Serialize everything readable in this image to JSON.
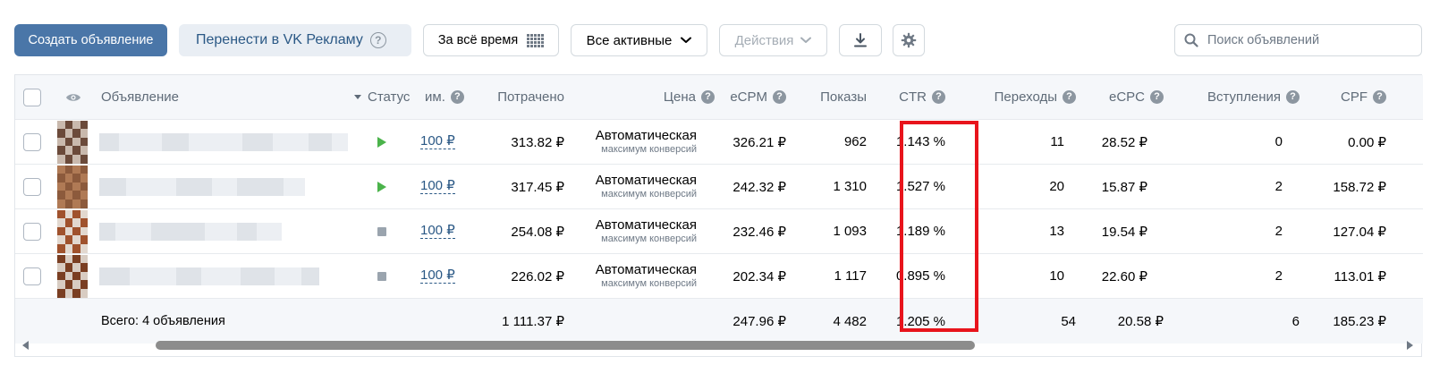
{
  "toolbar": {
    "create_label": "Создать объявление",
    "transfer_label": "Перенести в VK Рекламу",
    "period_label": "За всё время",
    "filter_label": "Все активные",
    "actions_label": "Действия",
    "search_placeholder": "Поиск объявлений"
  },
  "table": {
    "headers": {
      "ad": "Объявление",
      "status": "Статус",
      "budget": "им.",
      "spent": "Потрачено",
      "price": "Цена",
      "ecpm": "eCPM",
      "impressions": "Показы",
      "ctr": "CTR",
      "clicks": "Переходы",
      "ecpc": "eCPC",
      "joins": "Вступления",
      "cpf": "CPF"
    },
    "rows": [
      {
        "status": "active",
        "budget": "100 ₽",
        "spent": "313.82 ₽",
        "price_mode": "Автоматическая",
        "price_sub": "максимум конверсий",
        "ecpm": "326.21 ₽",
        "impressions": "962",
        "ctr": "1.143 %",
        "clicks": "11",
        "ecpc": "28.52 ₽",
        "joins": "0",
        "cpf": "0.00 ₽"
      },
      {
        "status": "active",
        "budget": "100 ₽",
        "spent": "317.45 ₽",
        "price_mode": "Автоматическая",
        "price_sub": "максимум конверсий",
        "ecpm": "242.32 ₽",
        "impressions": "1 310",
        "ctr": "1.527 %",
        "clicks": "20",
        "ecpc": "15.87 ₽",
        "joins": "2",
        "cpf": "158.72 ₽"
      },
      {
        "status": "stopped",
        "budget": "100 ₽",
        "spent": "254.08 ₽",
        "price_mode": "Автоматическая",
        "price_sub": "максимум конверсий",
        "ecpm": "232.46 ₽",
        "impressions": "1 093",
        "ctr": "1.189 %",
        "clicks": "13",
        "ecpc": "19.54 ₽",
        "joins": "2",
        "cpf": "127.04 ₽"
      },
      {
        "status": "stopped",
        "budget": "100 ₽",
        "spent": "226.02 ₽",
        "price_mode": "Автоматическая",
        "price_sub": "максимум конверсий",
        "ecpm": "202.34 ₽",
        "impressions": "1 117",
        "ctr": "0.895 %",
        "clicks": "10",
        "ecpc": "22.60 ₽",
        "joins": "2",
        "cpf": "113.01 ₽"
      }
    ],
    "total": {
      "label": "Всего: 4 объявления",
      "spent": "1 111.37 ₽",
      "ecpm": "247.96 ₽",
      "impressions": "4 482",
      "ctr": "1.205 %",
      "clicks": "54",
      "ecpc": "20.58 ₽",
      "joins": "6",
      "cpf": "185.23 ₽"
    }
  },
  "colors": {
    "primary": "#4a76a8",
    "link": "#2a5885",
    "active_status": "#4bb34b",
    "highlight": "#e8141c"
  }
}
